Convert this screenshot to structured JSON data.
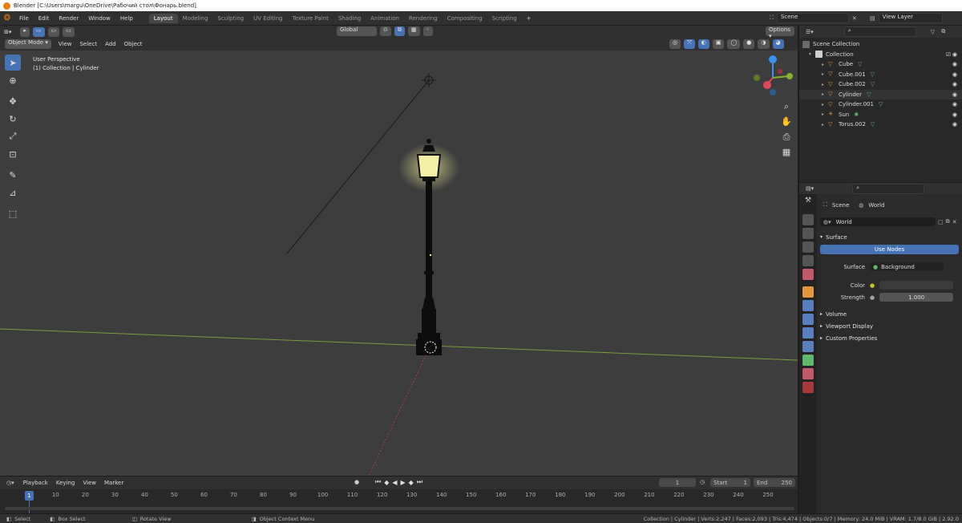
{
  "window_title": "Blender [C:\\Users\\margu\\OneDrive\\Рабочий стол\\Фонарь.blend]",
  "menu": [
    "File",
    "Edit",
    "Render",
    "Window",
    "Help"
  ],
  "workspaces": [
    "Layout",
    "Modeling",
    "Sculpting",
    "UV Editing",
    "Texture Paint",
    "Shading",
    "Animation",
    "Rendering",
    "Compositing",
    "Scripting"
  ],
  "active_workspace": "Layout",
  "scene_name": "Scene",
  "view_layer": "View Layer",
  "viewport": {
    "mode": "Object Mode",
    "menus": [
      "View",
      "Select",
      "Add",
      "Object"
    ],
    "transform_orientation": "Global",
    "options_label": "Options",
    "info_line1": "User Perspective",
    "info_line2": "(1) Collection | Cylinder"
  },
  "outliner": {
    "root": "Scene Collection",
    "collection": "Collection",
    "items": [
      {
        "name": "Cube",
        "icon": "mesh-icon"
      },
      {
        "name": "Cube.001",
        "icon": "mesh-icon"
      },
      {
        "name": "Cube.002",
        "icon": "mesh-icon"
      },
      {
        "name": "Cylinder",
        "icon": "mesh-icon"
      },
      {
        "name": "Cylinder.001",
        "icon": "mesh-icon"
      },
      {
        "name": "Sun",
        "icon": "light-icon"
      },
      {
        "name": "Torus.002",
        "icon": "mesh-icon"
      }
    ]
  },
  "properties": {
    "scene_label": "Scene",
    "world_label": "World",
    "world_name": "World",
    "surface_panel": "Surface",
    "use_nodes": "Use Nodes",
    "surface_label": "Surface",
    "surface_value": "Background",
    "color_label": "Color",
    "strength_label": "Strength",
    "strength_value": "1.000",
    "volume_panel": "Volume",
    "viewport_display_panel": "Viewport Display",
    "custom_props_panel": "Custom Properties"
  },
  "timeline": {
    "menus": [
      "Playback",
      "Keying",
      "View",
      "Marker"
    ],
    "current_frame": "1",
    "start_label": "Start",
    "start_value": "1",
    "end_label": "End",
    "end_value": "250",
    "ticks": [
      "1",
      "10",
      "20",
      "30",
      "40",
      "50",
      "60",
      "70",
      "80",
      "90",
      "100",
      "110",
      "120",
      "130",
      "140",
      "150",
      "160",
      "170",
      "180",
      "190",
      "200",
      "210",
      "220",
      "230",
      "240",
      "250"
    ]
  },
  "status": {
    "select": "Select",
    "box_select": "Box Select",
    "rotate_view": "Rotate View",
    "context_menu": "Object Context Menu",
    "stats": "Collection | Cylinder | Verts:2,247 | Faces:2,093 | Tris:4,474 | Objects:0/7 | Memory: 24.0 MiB | VRAM: 1.7/8.0 GiB | 2.92.0"
  },
  "colors": {
    "accent": "#4772b3",
    "lamp_glow": "#f3f19a",
    "x_axis": "#e0485a",
    "y_axis": "#88b22e",
    "z_axis": "#3d8ee8"
  }
}
